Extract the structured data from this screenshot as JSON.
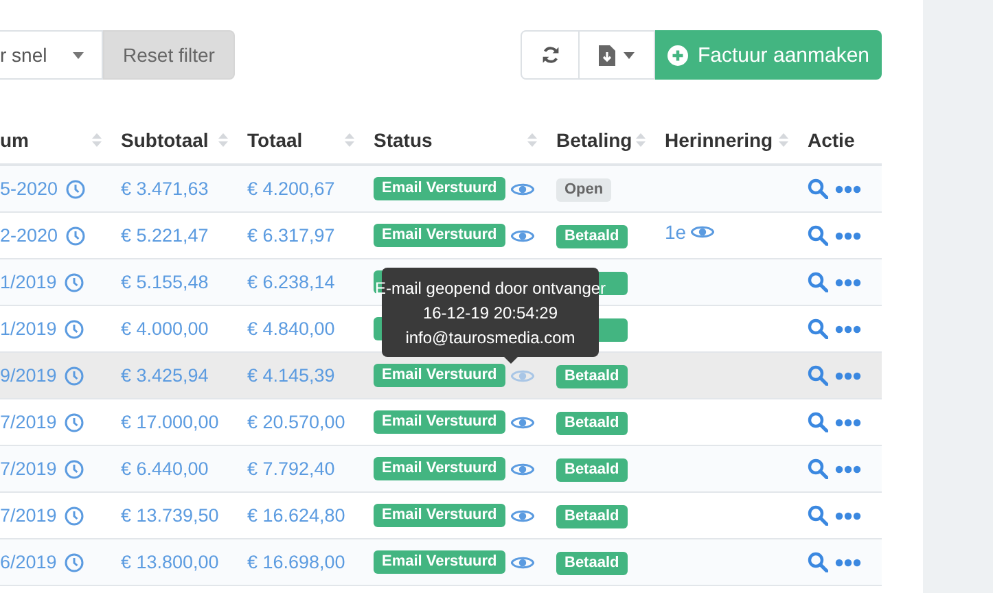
{
  "toolbar": {
    "filter_select": {
      "value": "r snel"
    },
    "reset_button": "Reset filter",
    "create_button": "Factuur aanmaken"
  },
  "table": {
    "columns": [
      {
        "label": "um",
        "sortable": true
      },
      {
        "label": "Subtotaal",
        "sortable": true
      },
      {
        "label": "Totaal",
        "sortable": true
      },
      {
        "label": "Status",
        "sortable": true
      },
      {
        "label": "Betaling",
        "sortable": true
      },
      {
        "label": "Herinnering",
        "sortable": true
      },
      {
        "label": "Actie",
        "sortable": false
      }
    ],
    "rows": [
      {
        "date": "5-2020",
        "subtotal": "€ 3.471,63",
        "total": "€ 4.200,67",
        "status": "Email Verstuurd",
        "payment": {
          "label": "Open",
          "kind": "open"
        },
        "highlighted": false
      },
      {
        "date": "2-2020",
        "subtotal": "€ 5.221,47",
        "total": "€ 6.317,97",
        "status": "Email Verstuurd",
        "payment": {
          "label": "Betaald",
          "kind": "paid"
        },
        "reminder": "1e",
        "highlighted": false
      },
      {
        "date": "1/2019",
        "subtotal": "€ 5.155,48",
        "total": "€ 6.238,14",
        "payment": {
          "kind": "paid"
        },
        "highlighted": false
      },
      {
        "date": "1/2019",
        "subtotal": "€ 4.000,00",
        "total": "€ 4.840,00",
        "payment": {
          "kind": "paid"
        },
        "highlighted": false
      },
      {
        "date": "9/2019",
        "subtotal": "€ 3.425,94",
        "total": "€ 4.145,39",
        "status": "Email Verstuurd",
        "payment": {
          "label": "Betaald",
          "kind": "paid"
        },
        "highlighted": true,
        "tooltip": [
          "E-mail geopend door ontvanger",
          "16-12-19 20:54:29",
          "info@taurosmedia.com"
        ]
      },
      {
        "date": "7/2019",
        "subtotal": "€ 17.000,00",
        "total": "€ 20.570,00",
        "status": "Email Verstuurd",
        "payment": {
          "label": "Betaald",
          "kind": "paid"
        },
        "highlighted": false
      },
      {
        "date": "7/2019",
        "subtotal": "€ 6.440,00",
        "total": "€ 7.792,40",
        "status": "Email Verstuurd",
        "payment": {
          "label": "Betaald",
          "kind": "paid"
        },
        "highlighted": false
      },
      {
        "date": "7/2019",
        "subtotal": "€ 13.739,50",
        "total": "€ 16.624,80",
        "status": "Email Verstuurd",
        "payment": {
          "label": "Betaald",
          "kind": "paid"
        },
        "highlighted": false
      },
      {
        "date": "6/2019",
        "subtotal": "€ 13.800,00",
        "total": "€ 16.698,00",
        "status": "Email Verstuurd",
        "payment": {
          "label": "Betaald",
          "kind": "paid"
        },
        "highlighted": false
      }
    ]
  }
}
